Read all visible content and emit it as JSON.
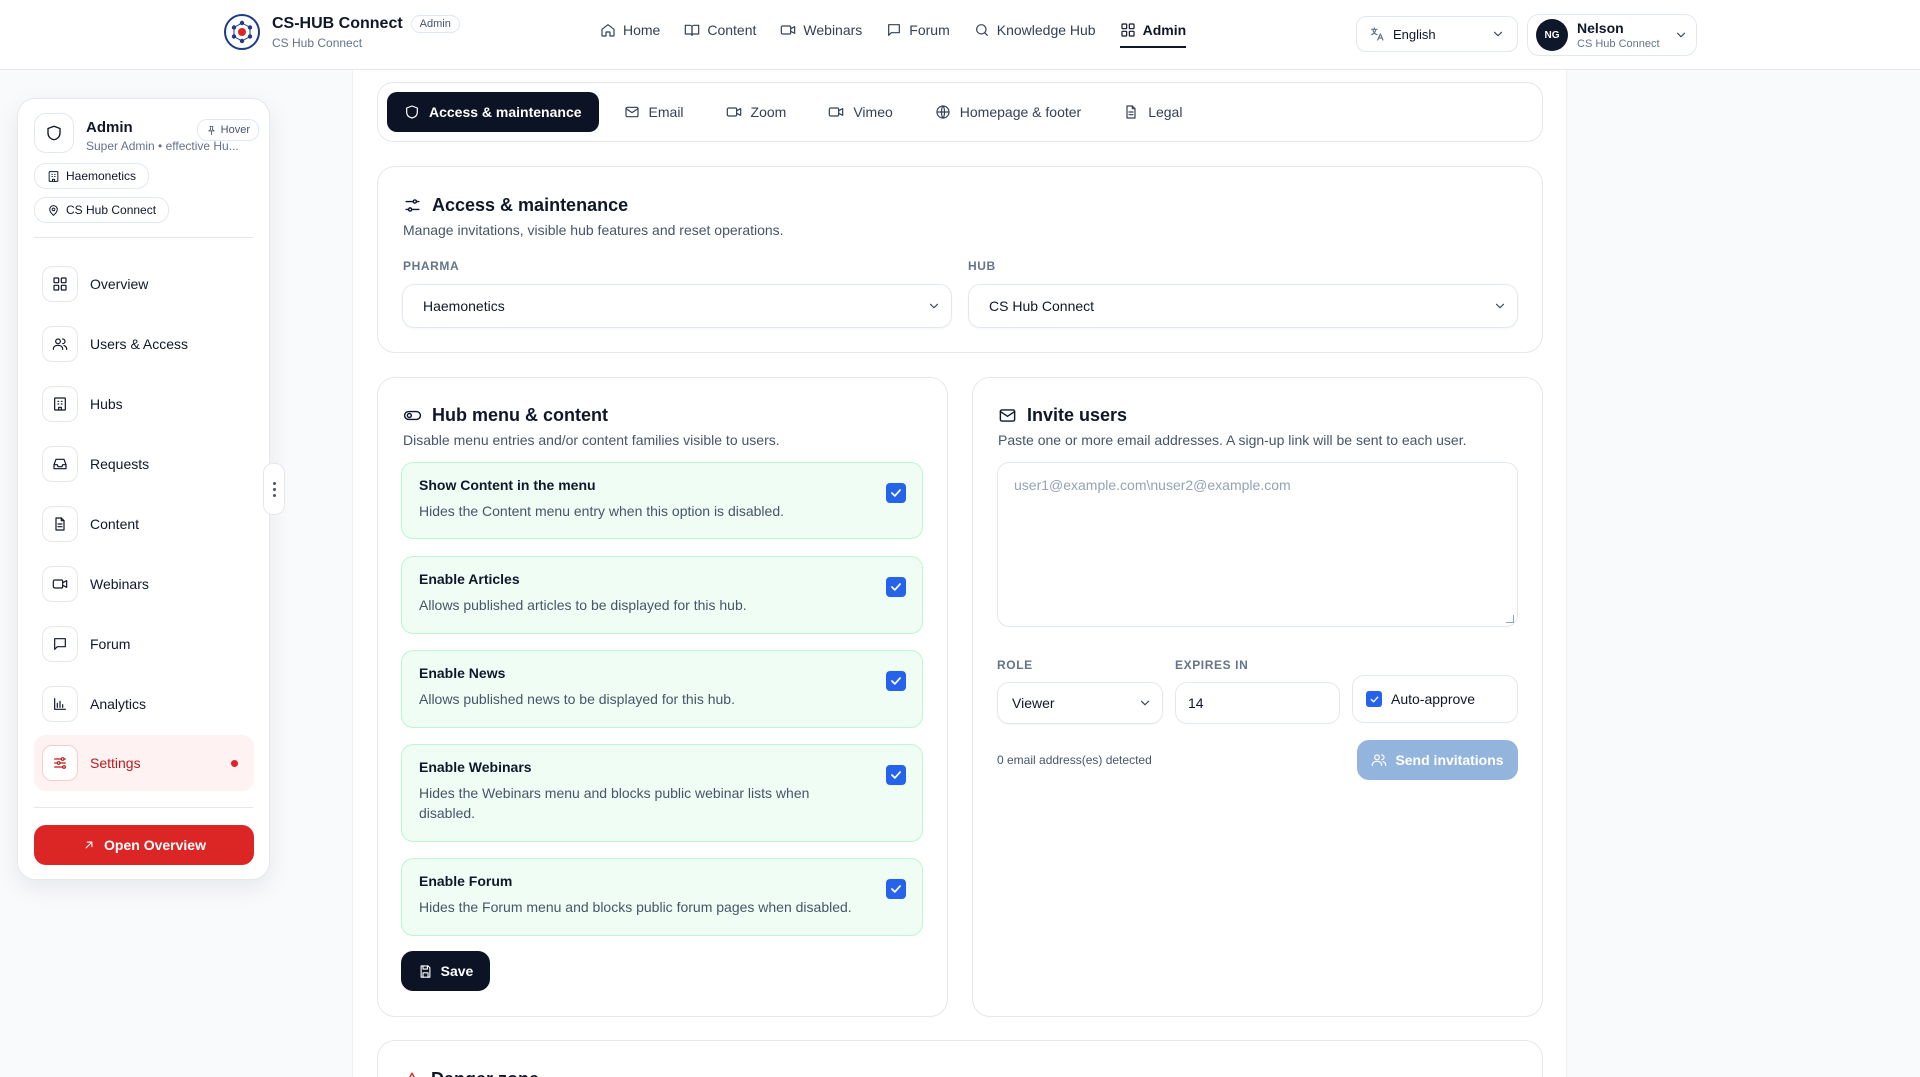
{
  "brand": {
    "title": "CS-HUB Connect",
    "badge": "Admin",
    "subtitle": "CS Hub Connect"
  },
  "topnav": [
    {
      "label": "Home",
      "icon": "home-icon"
    },
    {
      "label": "Content",
      "icon": "book-icon"
    },
    {
      "label": "Webinars",
      "icon": "video-icon"
    },
    {
      "label": "Forum",
      "icon": "message-icon"
    },
    {
      "label": "Knowledge Hub",
      "icon": "search-icon"
    },
    {
      "label": "Admin",
      "icon": "grid-icon",
      "active": true
    }
  ],
  "language": {
    "selected": "English"
  },
  "user": {
    "initials": "NG",
    "name": "Nelson",
    "subtitle": "CS Hub Connect"
  },
  "sidebar": {
    "title": "Admin",
    "subtitle": "Super Admin • effective Hu...",
    "hover_label": "Hover",
    "chips": [
      "Haemonetics",
      "CS Hub Connect"
    ],
    "items": [
      {
        "label": "Overview",
        "icon": "grid-icon"
      },
      {
        "label": "Users & Access",
        "icon": "users-icon"
      },
      {
        "label": "Hubs",
        "icon": "building-icon"
      },
      {
        "label": "Requests",
        "icon": "inbox-icon"
      },
      {
        "label": "Content",
        "icon": "file-icon"
      },
      {
        "label": "Webinars",
        "icon": "video-icon"
      },
      {
        "label": "Forum",
        "icon": "message-icon"
      },
      {
        "label": "Analytics",
        "icon": "bar-chart-icon"
      },
      {
        "label": "Settings",
        "icon": "sliders-icon",
        "active": true
      }
    ],
    "open_overview": "Open Overview"
  },
  "tabs": [
    {
      "label": "Access & maintenance",
      "icon": "shield-icon",
      "active": true
    },
    {
      "label": "Email",
      "icon": "mail-icon"
    },
    {
      "label": "Zoom",
      "icon": "video-icon"
    },
    {
      "label": "Vimeo",
      "icon": "video-icon"
    },
    {
      "label": "Homepage & footer",
      "icon": "globe-icon"
    },
    {
      "label": "Legal",
      "icon": "file-icon"
    }
  ],
  "access": {
    "title": "Access & maintenance",
    "description": "Manage invitations, visible hub features and reset operations.",
    "pharma_label": "PHARMA",
    "pharma_value": "Haemonetics",
    "hub_label": "HUB",
    "hub_value": "CS Hub Connect"
  },
  "hub_menu": {
    "title": "Hub menu & content",
    "description": "Disable menu entries and/or content families visible to users.",
    "options": [
      {
        "title": "Show Content in the menu",
        "desc": "Hides the Content menu entry when this option is disabled.",
        "checked": true
      },
      {
        "title": "Enable Articles",
        "desc": "Allows published articles to be displayed for this hub.",
        "checked": true
      },
      {
        "title": "Enable News",
        "desc": "Allows published news to be displayed for this hub.",
        "checked": true
      },
      {
        "title": "Enable Webinars",
        "desc": "Hides the Webinars menu and blocks public webinar lists when disabled.",
        "checked": true
      },
      {
        "title": "Enable Forum",
        "desc": "Hides the Forum menu and blocks public forum pages when disabled.",
        "checked": true
      }
    ],
    "save_label": "Save"
  },
  "invite": {
    "title": "Invite users",
    "description": "Paste one or more email addresses. A sign-up link will be sent to each user.",
    "placeholder": "user1@example.com\\nuser2@example.com",
    "role_label": "ROLE",
    "role_value": "Viewer",
    "expires_label": "EXPIRES IN",
    "expires_value": "14",
    "auto_approve_label": "Auto-approve",
    "auto_approve_checked": true,
    "detected": "0 email address(es) detected",
    "send_label": "Send invitations"
  },
  "danger": {
    "title": "Danger zone"
  },
  "colors": {
    "primary_dark": "#0b1324",
    "accent_red": "#dc2626",
    "checkbox_blue": "#2563eb",
    "option_bg": "#f0fdf4"
  }
}
